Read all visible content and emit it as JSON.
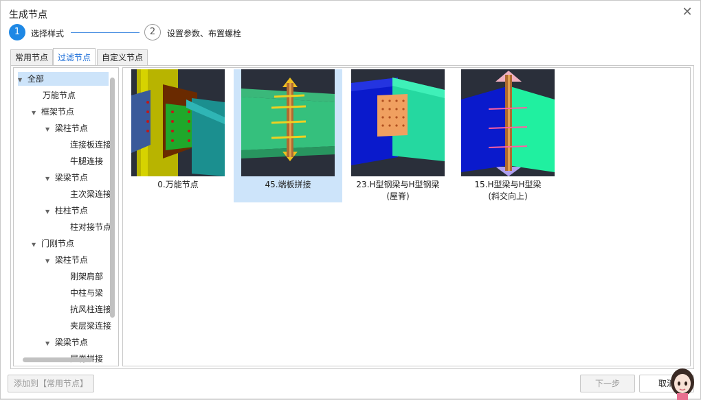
{
  "dialog": {
    "title": "生成节点",
    "close_glyph": "✕"
  },
  "steps": [
    {
      "number": "1",
      "label": "选择样式"
    },
    {
      "number": "2",
      "label": "设置参数、布置螺栓"
    }
  ],
  "tabs": [
    {
      "label": "常用节点"
    },
    {
      "label": "过滤节点"
    },
    {
      "label": "自定义节点"
    }
  ],
  "tree": [
    {
      "label": "全部",
      "arrow": "▼"
    },
    {
      "label": "万能节点",
      "arrow": ""
    },
    {
      "label": "框架节点",
      "arrow": "▼"
    },
    {
      "label": "梁柱节点",
      "arrow": "▼"
    },
    {
      "label": "连接板连接",
      "arrow": ""
    },
    {
      "label": "牛腿连接",
      "arrow": ""
    },
    {
      "label": "梁梁节点",
      "arrow": "▼"
    },
    {
      "label": "主次梁连接",
      "arrow": ""
    },
    {
      "label": "柱柱节点",
      "arrow": "▼"
    },
    {
      "label": "柱对接节点",
      "arrow": ""
    },
    {
      "label": "门刚节点",
      "arrow": "▼"
    },
    {
      "label": "梁柱节点",
      "arrow": "▼"
    },
    {
      "label": "刚架肩部",
      "arrow": ""
    },
    {
      "label": "中柱与梁",
      "arrow": ""
    },
    {
      "label": "抗风柱连接",
      "arrow": ""
    },
    {
      "label": "夹层梁连接",
      "arrow": ""
    },
    {
      "label": "梁梁节点",
      "arrow": "▼"
    },
    {
      "label": "屋脊拼接",
      "arrow": ""
    }
  ],
  "nodes": [
    {
      "caption": "0.万能节点"
    },
    {
      "caption": "45.端板拼接"
    },
    {
      "caption": "23.H型钢梁与H型钢梁\n(屋脊)"
    },
    {
      "caption": "15.H型梁与H型梁\n(斜交向上)"
    }
  ],
  "buttons": {
    "add_common": "添加到【常用节点】",
    "next": "下一步",
    "cancel": "取消"
  },
  "colors": {
    "accent": "#1e88e5",
    "selection": "#cde4fa"
  }
}
